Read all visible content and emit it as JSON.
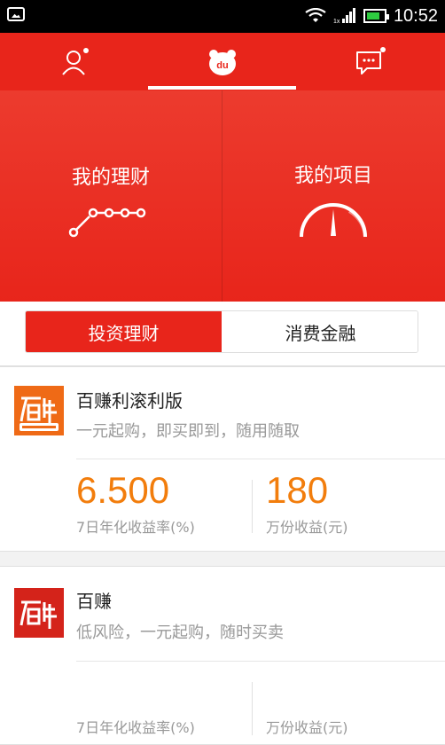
{
  "status_bar": {
    "time": "10:52",
    "network_badge": "1x"
  },
  "top_nav": {
    "items": [
      {
        "name": "profile",
        "icon": "user-icon"
      },
      {
        "name": "home",
        "icon": "bear-du-icon",
        "label": "du"
      },
      {
        "name": "messages",
        "icon": "chat-icon"
      }
    ],
    "active_index": 1
  },
  "hero": {
    "left": {
      "title": "我的理财",
      "icon": "line-chart-icon"
    },
    "right": {
      "title": "我的项目",
      "icon": "gauge-icon"
    }
  },
  "tabs": {
    "active": "投资理财",
    "inactive": "消费金融"
  },
  "products": [
    {
      "logo": "baizhuan-li-gun-li-logo",
      "name": "百赚利滚利版",
      "desc": "一元起购，即买即到，随用随取",
      "rate": "6.500",
      "rate_label": "7日年化收益率(%)",
      "earn": "180",
      "earn_label": "万份收益(元)"
    },
    {
      "logo": "baizhuan-logo",
      "name": "百赚",
      "desc": "低风险，一元起购，随时买卖",
      "rate": "",
      "rate_label": "7日年化收益率(%)",
      "earn": "",
      "earn_label": "万份收益(元)"
    }
  ],
  "colors": {
    "brand_red": "#e8251b",
    "accent_orange": "#f27d0c"
  }
}
